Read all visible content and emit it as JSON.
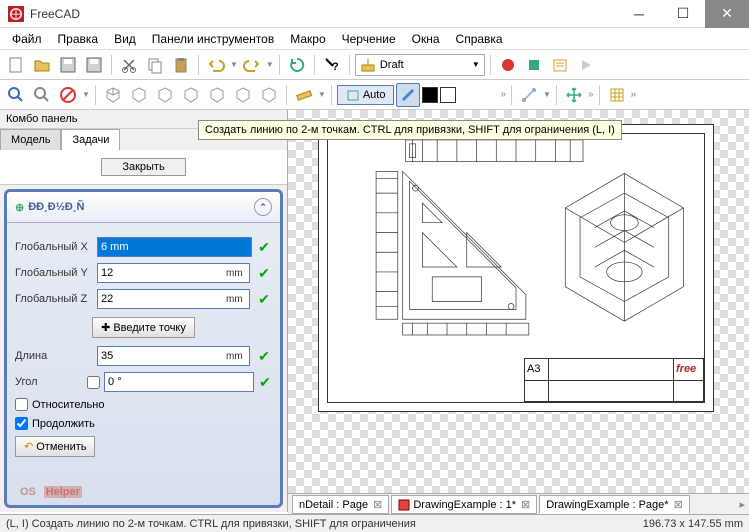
{
  "window": {
    "title": "FreeCAD"
  },
  "menu": [
    "Файл",
    "Правка",
    "Вид",
    "Панели инструментов",
    "Макро",
    "Черчение",
    "Окна",
    "Справка"
  ],
  "workbench": {
    "selected": "Draft"
  },
  "toolbar2": {
    "auto": "Auto"
  },
  "tooltip": "Создать линию по 2-м точкам. CTRL для привязки, SHIFT для ограничения (L, I)",
  "panel": {
    "title": "Комбо панель",
    "tabs": {
      "model": "Модель",
      "tasks": "Задачи"
    },
    "close": "Закрыть",
    "section_title": "ÐÐ¸Ð½Ð¸Ñ",
    "fields": {
      "gx_label": "Глобальный X",
      "gx_value": "6 mm",
      "gy_label": "Глобальный Y",
      "gy_value": "12",
      "gy_unit": "mm",
      "gz_label": "Глобальный Z",
      "gz_value": "22",
      "gz_unit": "mm",
      "enter_point": "Введите точку",
      "length_label": "Длина",
      "length_value": "35",
      "length_unit": "mm",
      "angle_label": "Угол",
      "angle_value": "0 °",
      "relative": "Относительно",
      "continue": "Продолжить",
      "cancel": "Отменить"
    }
  },
  "title_block": {
    "format": "A3",
    "logo": "free"
  },
  "doctabs": [
    {
      "label": "nDetail : Page",
      "icon": "page"
    },
    {
      "label": "DrawingExample : 1*",
      "icon": "doc"
    },
    {
      "label": "DrawingExample : Page*",
      "icon": "page"
    }
  ],
  "status": {
    "hint": "(L, I) Создать линию по 2-м точкам. CTRL для привязки, SHIFT для ограничения",
    "coords": "196.73 x 147.55 mm"
  },
  "watermark": {
    "a": "OS",
    "b": "Helper"
  }
}
